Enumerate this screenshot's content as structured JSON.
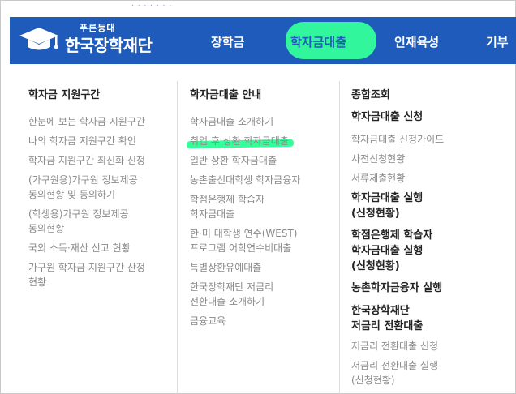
{
  "logo": {
    "sub": "푸른등대",
    "main": "한국장학재단",
    "brand_color": "#1f5bbb"
  },
  "nav": [
    {
      "label": "장학금"
    },
    {
      "label": "학자금대출"
    },
    {
      "label": "인재육성"
    },
    {
      "label": "기부"
    }
  ],
  "highlight_color": "#33ff99",
  "columns": [
    {
      "title": "학자금 지원구간",
      "links": [
        "한눈에 보는 학자금 지원구간",
        "나의 학자금 지원구간 확인",
        "학자금 지원구간 최신화 신청",
        "(가구원용)가구원 정보제공",
        "동의현황 및 동의하기",
        "(학생용)가구원 정보제공",
        "동의현황",
        "국외 소득·재산 신고 현황",
        "가구원 학자금 지원구간 산정",
        "현황"
      ]
    },
    {
      "title": "학자금대출 안내",
      "links": [
        "학자금대출 소개하기",
        "취업 후 상환 학자금대출",
        "일반 상환 학자금대출",
        "농촌출신대학생 학자금융자",
        "학점은행제 학습자",
        "학자금대출",
        "한·미 대학생 연수(WEST)",
        "프로그램 어학연수비대출",
        "특별상환유예대출",
        "한국장학재단 저금리",
        "전환대출 소개하기",
        "금융교육"
      ]
    },
    {
      "title": "종합조회",
      "sections": [
        {
          "title": [
            "학자금대출 신청"
          ],
          "links": [
            "학자금대출 신청가이드",
            "사전신청현황",
            "서류제출현황"
          ]
        },
        {
          "title": [
            "학자금대출 실행",
            "(신청현황)"
          ],
          "links": []
        },
        {
          "title": [
            "학점은행제 학습자",
            "학자금대출 실행",
            "(신청현황)"
          ],
          "links": []
        },
        {
          "title": [
            "농촌학자금융자 실행"
          ],
          "links": []
        },
        {
          "title": [
            "한국장학재단",
            "저금리 전환대출"
          ],
          "links": [
            "저금리 전환대출 신청",
            "저금리 전환대출 실행",
            "(신청현황)"
          ]
        }
      ]
    }
  ]
}
